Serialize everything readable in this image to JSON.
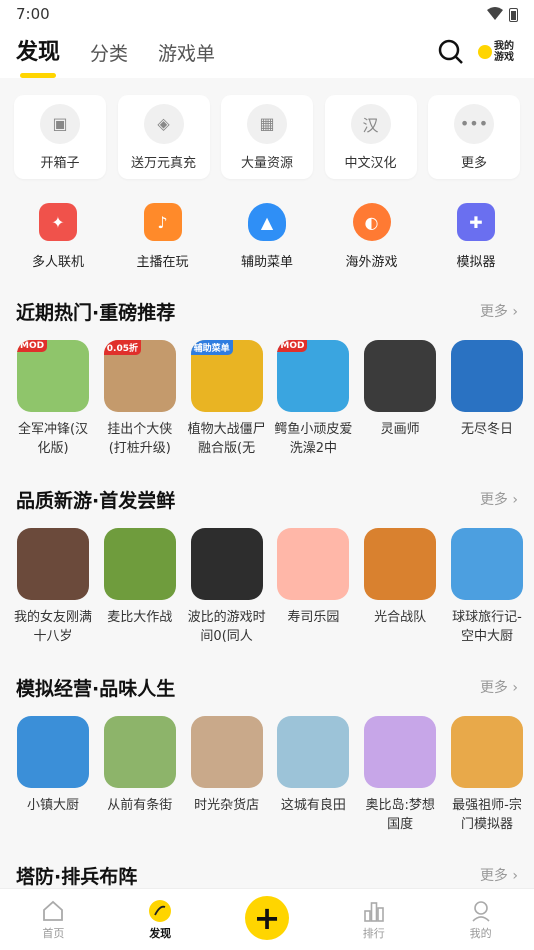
{
  "status": {
    "time": "7:00"
  },
  "header": {
    "tabs": [
      {
        "label": "发现",
        "active": true
      },
      {
        "label": "分类",
        "active": false
      },
      {
        "label": "游戏单",
        "active": false
      }
    ],
    "my_games_label_1": "我的",
    "my_games_label_2": "游戏"
  },
  "quick": [
    {
      "label": "开箱子",
      "icon": "box-icon"
    },
    {
      "label": "送万元真充",
      "icon": "gift-icon"
    },
    {
      "label": "大量资源",
      "icon": "grid-icon"
    },
    {
      "label": "中文汉化",
      "icon": "chinese-icon"
    },
    {
      "label": "更多",
      "icon": "more-icon"
    }
  ],
  "cats": [
    {
      "label": "多人联机",
      "icon": "multiplayer-icon",
      "color": "#f0524b"
    },
    {
      "label": "主播在玩",
      "icon": "tv-icon",
      "color": "#ff8a2a"
    },
    {
      "label": "辅助菜单",
      "icon": "flame-icon",
      "color": "#2f8ff6"
    },
    {
      "label": "海外游戏",
      "icon": "planet-icon",
      "color": "#ff7a33"
    },
    {
      "label": "模拟器",
      "icon": "gamepad-icon",
      "color": "#6a6ff0"
    }
  ],
  "sections": [
    {
      "title": "近期热门·重磅推荐",
      "more": "更多",
      "games": [
        {
          "name": "全军冲锋(汉化版)",
          "tag": "MOD",
          "color": "#8fc56b"
        },
        {
          "name": "挂出个大侠(打桩升级)",
          "tag": "0.05折",
          "color": "#c49a6c"
        },
        {
          "name": "植物大战僵尸融合版(无",
          "tag": "辅助菜单",
          "color": "#e9b423"
        },
        {
          "name": "鳄鱼小顽皮爱洗澡2中",
          "tag": "MOD",
          "color": "#3aa5e0"
        },
        {
          "name": "灵画师",
          "tag": "",
          "color": "#3b3b3b"
        },
        {
          "name": "无尽冬日",
          "tag": "",
          "color": "#2a72c2"
        }
      ]
    },
    {
      "title": "品质新游·首发尝鲜",
      "more": "更多",
      "games": [
        {
          "name": "我的女友刚满十八岁",
          "tag": "",
          "color": "#6b4a3b"
        },
        {
          "name": "麦比大作战",
          "tag": "",
          "color": "#6f9c3d"
        },
        {
          "name": "波比的游戏时间0(同人",
          "tag": "",
          "color": "#2d2d2d"
        },
        {
          "name": "寿司乐园",
          "tag": "",
          "color": "#ffb7a8"
        },
        {
          "name": "光合战队",
          "tag": "",
          "color": "#d9812f"
        },
        {
          "name": "球球旅行记-空中大厨",
          "tag": "",
          "color": "#4c9fe0"
        }
      ]
    },
    {
      "title": "模拟经营·品味人生",
      "more": "更多",
      "games": [
        {
          "name": "小镇大厨",
          "tag": "",
          "color": "#3b8fd8"
        },
        {
          "name": "从前有条街",
          "tag": "",
          "color": "#8db46a"
        },
        {
          "name": "时光杂货店",
          "tag": "",
          "color": "#c9a98a"
        },
        {
          "name": "这城有良田",
          "tag": "",
          "color": "#9cc3d8"
        },
        {
          "name": "奥比岛:梦想国度",
          "tag": "",
          "color": "#c7a6e8"
        },
        {
          "name": "最强祖师-宗门模拟器",
          "tag": "",
          "color": "#e8a94a"
        }
      ]
    },
    {
      "title": "塔防·排兵布阵",
      "more": "更多",
      "games": []
    }
  ],
  "nav": [
    {
      "label": "首页",
      "icon": "home-icon"
    },
    {
      "label": "发现",
      "icon": "discover-icon",
      "active": true
    },
    {
      "label": "",
      "icon": "plus-icon"
    },
    {
      "label": "排行",
      "icon": "ranking-icon"
    },
    {
      "label": "我的",
      "icon": "profile-icon"
    }
  ]
}
